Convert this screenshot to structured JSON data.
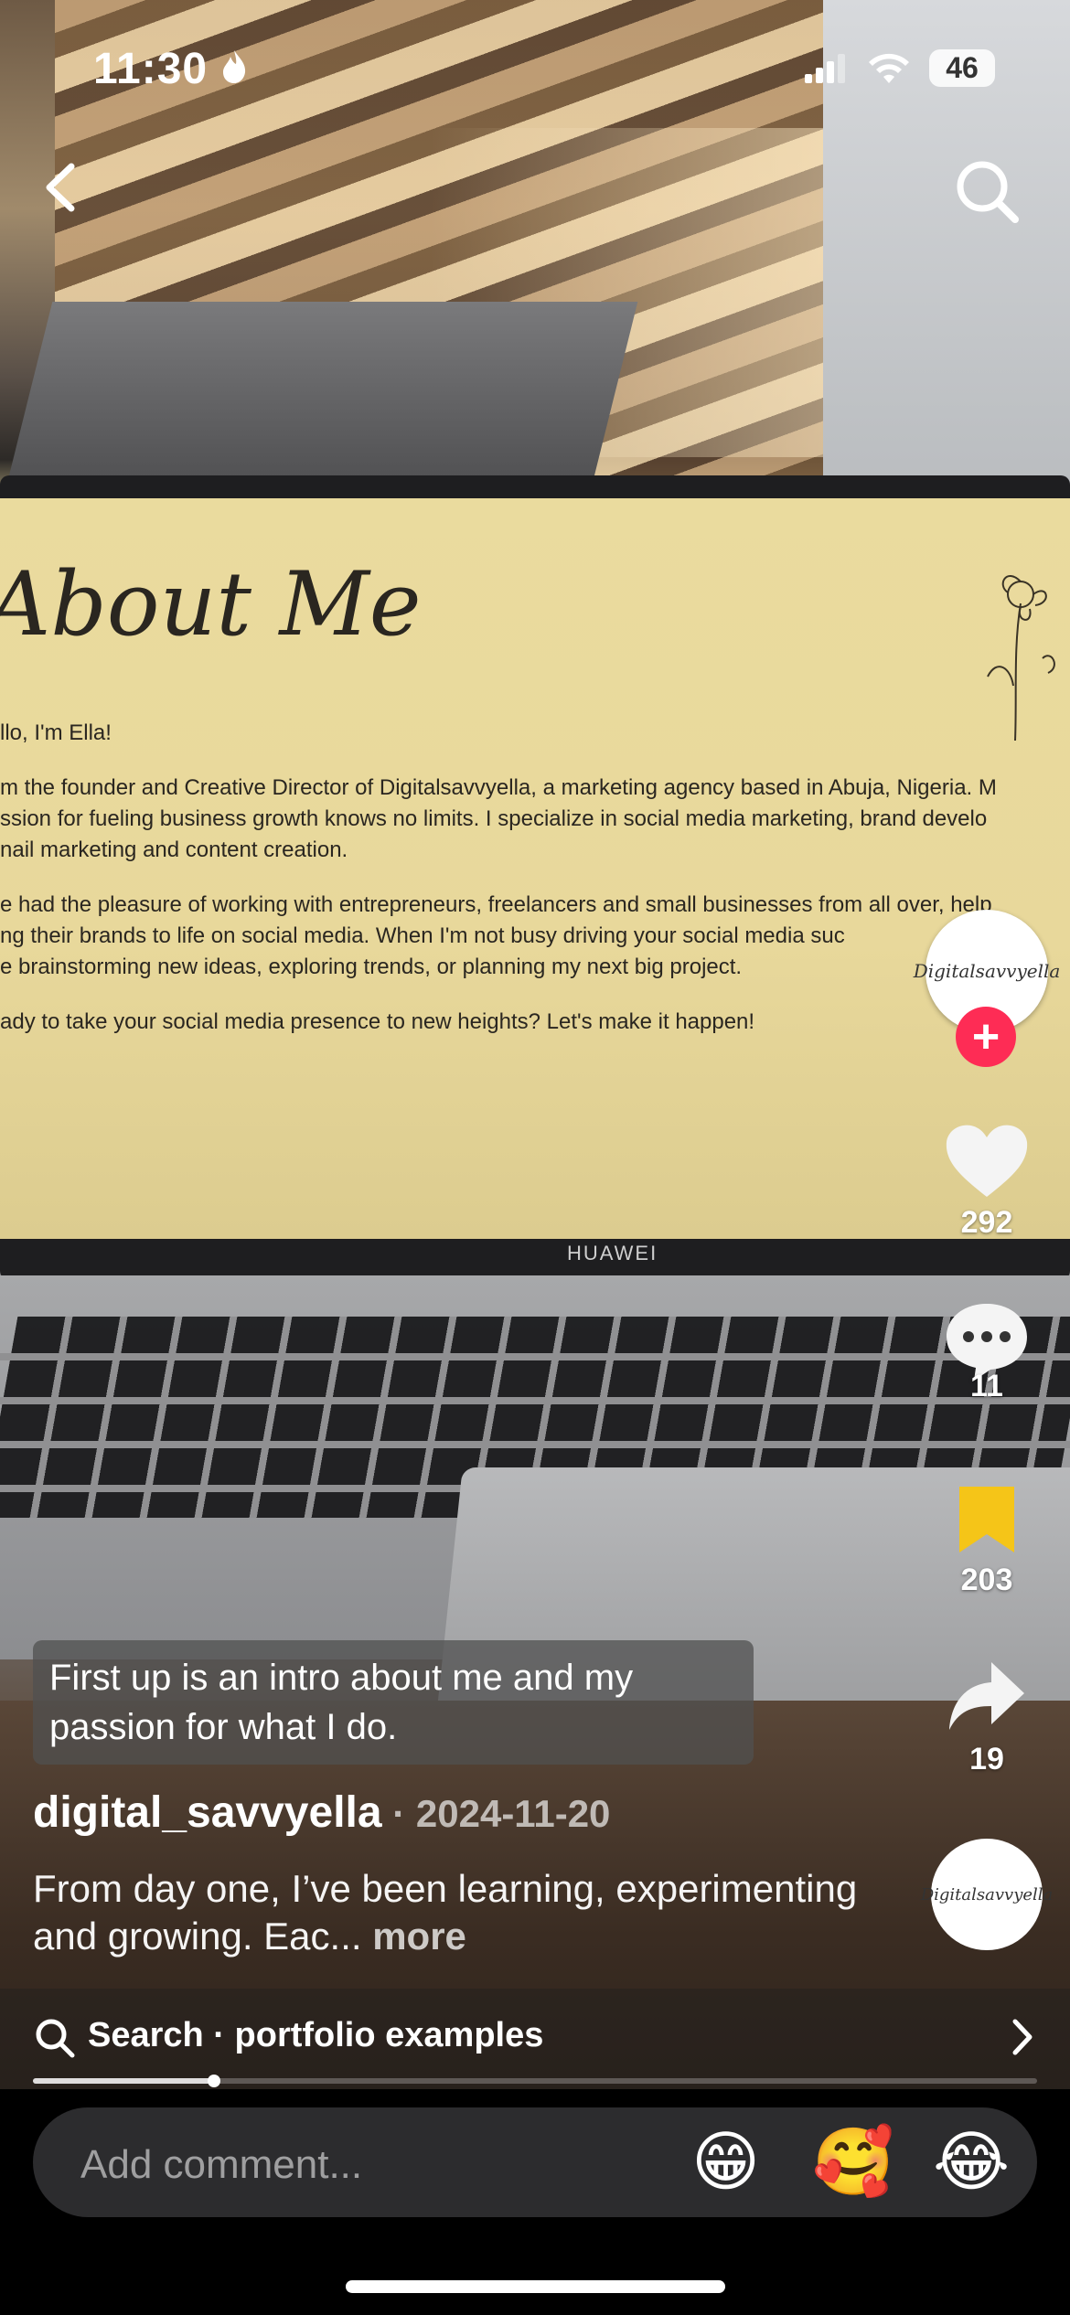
{
  "status_bar": {
    "time": "11:30",
    "battery": "46"
  },
  "video": {
    "screen_heading": "About Me",
    "screen_lines": [
      "llo, I'm Ella!",
      "m the founder and Creative Director of Digitalsavvyella, a marketing agency based in Abuja, Nigeria. M",
      "ssion for fueling business growth knows no limits. I specialize in social media marketing, brand develo",
      "nail marketing and content creation.",
      "e had the pleasure of working with entrepreneurs, freelancers and small businesses from all over, help",
      "ng their brands to life on social media. When I'm not busy driving your social media suc",
      "e brainstorming new ideas, exploring trends, or planning my next big project.",
      "ady to take your social media presence to new heights? Let's make it happen!"
    ],
    "laptop_brand": "HUAWEI"
  },
  "rail": {
    "avatar_text": "Digitalsavvyella",
    "likes": "292",
    "comments": "11",
    "saves": "203",
    "shares": "19",
    "music_text": "Digitalsavvyella"
  },
  "caption": {
    "sticker_text": "First up is an intro about me and my passion for what I do.",
    "username": "digital_savvyella",
    "date": " · 2024-11-20",
    "description": "From day one, I’ve been learning, experimenting and growing.  Eac...",
    "more": " more"
  },
  "search_bar": {
    "label": "Search · portfolio examples"
  },
  "progress": {
    "fraction": 0.18
  },
  "comment": {
    "placeholder": "Add comment...",
    "emojis": [
      "😁",
      "🥰",
      "😂"
    ]
  },
  "colors": {
    "accent": "#fe2c55",
    "save": "#f5c518"
  }
}
